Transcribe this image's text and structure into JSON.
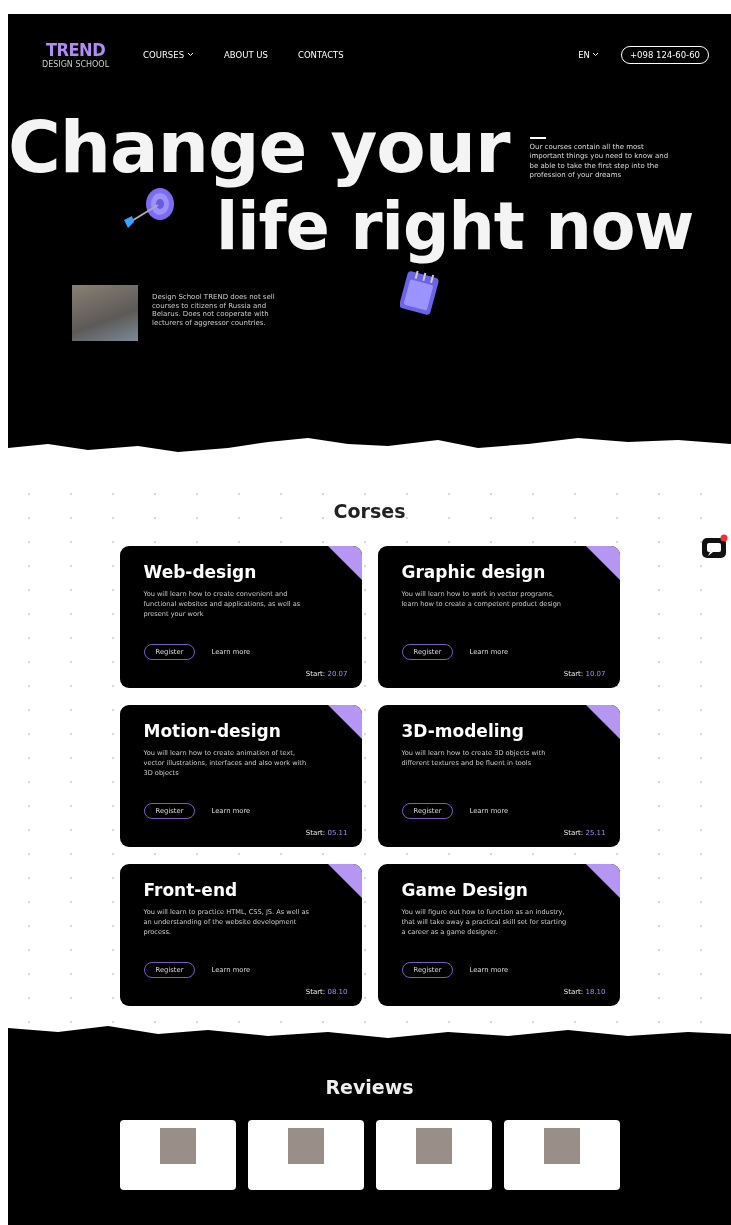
{
  "header": {
    "logo": "TREND",
    "logo_subtitle": "DESIGN SCHOOL",
    "nav": [
      {
        "label": "COURSES",
        "dropdown": true
      },
      {
        "label": "ABOUT US",
        "dropdown": false
      },
      {
        "label": "CONTACTS",
        "dropdown": false
      }
    ],
    "language": "EN",
    "phone": "+098 124-60-60"
  },
  "hero": {
    "title_line_1": "Change your",
    "title_line_2": "life right now",
    "intro": "Our courses contain all the most important things you need to know and be able to take the first step into the profession of your dreams",
    "notice": "Design School TREND does not sell courses to citizens of Russia and Belarus. Does not cooperate with lecturers of aggressor countries."
  },
  "courses": {
    "title": "Corses",
    "items": [
      {
        "title": "Web-design",
        "description": "You will learn how to create convenient and functional websites and applications, as well as present your work",
        "register": "Register",
        "learn_more": "Learn more",
        "start_label": "Start:",
        "start_date": "20.07"
      },
      {
        "title": "Graphic design",
        "description": "You will learn how to work in vector programs, learn how to create a competent product design",
        "register": "Register",
        "learn_more": "Learn more",
        "start_label": "Start:",
        "start_date": "10.07"
      },
      {
        "title": "Motion-design",
        "description": "You will learn how to create animation of text, vector illustrations, interfaces and also work with 3D objects",
        "register": "Register",
        "learn_more": "Learn more",
        "start_label": "Start:",
        "start_date": "05.11"
      },
      {
        "title": "3D-modeling",
        "description": "You will learn how to create 3D objects with different textures and be fluent in tools",
        "register": "Register",
        "learn_more": "Learn more",
        "start_label": "Start:",
        "start_date": "25.11"
      },
      {
        "title": "Front-end",
        "description": "You will learn to practice HTML, CSS, JS. As well as an understanding of the website development process.",
        "register": "Register",
        "learn_more": "Learn more",
        "start_label": "Start:",
        "start_date": "08.10"
      },
      {
        "title": "Game Design",
        "description": "You will figure out how to function as an industry, that will take away a practical skill set for starting a career as a game designer.",
        "register": "Register",
        "learn_more": "Learn more",
        "start_label": "Start:",
        "start_date": "18.10"
      }
    ]
  },
  "reviews": {
    "title": "Reviews",
    "cards": [
      {
        "kind": "photo"
      },
      {
        "kind": "photo"
      },
      {
        "kind": "photo"
      },
      {
        "kind": "photo"
      }
    ]
  }
}
